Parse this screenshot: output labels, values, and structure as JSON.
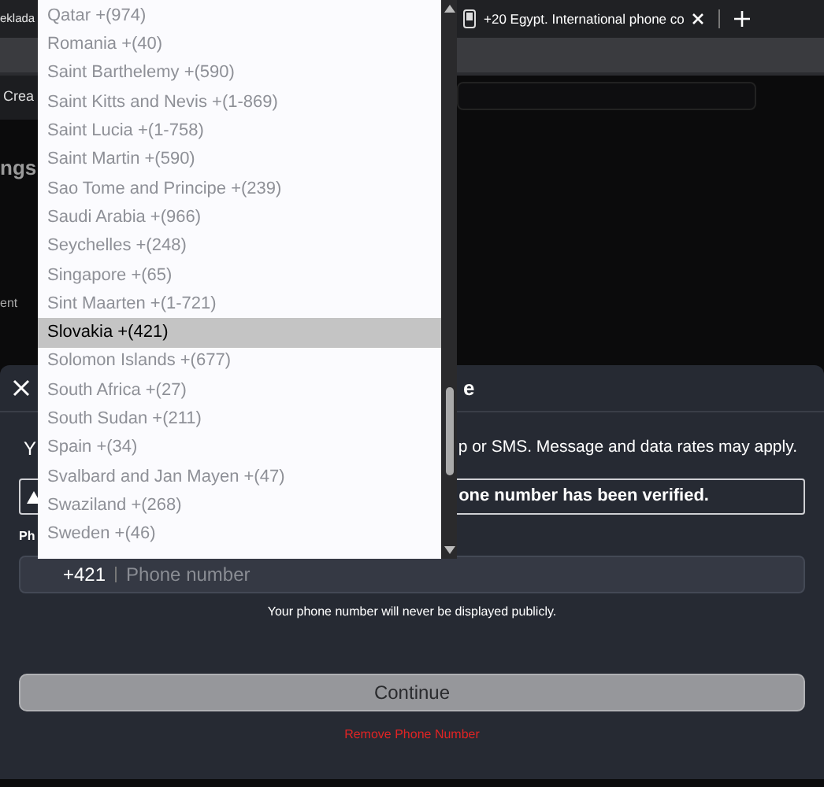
{
  "browser": {
    "tabs": [
      {
        "title": "eklada"
      },
      {
        "title": "+20 Egypt. International phone co"
      }
    ]
  },
  "page": {
    "left_fragments": [
      "Crea",
      "ngs",
      "ent"
    ]
  },
  "dialog": {
    "title": "e",
    "description_start": "Y",
    "description_end": "p or SMS. Message and data rates may apply.",
    "notice": "one number has been verified.",
    "field_label": "Ph",
    "country_code": "+421",
    "placeholder": "Phone number",
    "note": "Your phone number will never be displayed publicly.",
    "continue": "Continue",
    "remove": "Remove Phone Number"
  },
  "dropdown": {
    "items": [
      {
        "label": "Qatar +(974)",
        "selected": false
      },
      {
        "label": "Romania +(40)",
        "selected": false
      },
      {
        "label": "Saint Barthelemy +(590)",
        "selected": false
      },
      {
        "label": "Saint Kitts and Nevis +(1-869)",
        "selected": false
      },
      {
        "label": "Saint Lucia +(1-758)",
        "selected": false
      },
      {
        "label": "Saint Martin +(590)",
        "selected": false
      },
      {
        "label": "Sao Tome and Principe +(239)",
        "selected": false
      },
      {
        "label": "Saudi Arabia +(966)",
        "selected": false
      },
      {
        "label": "Seychelles +(248)",
        "selected": false
      },
      {
        "label": "Singapore +(65)",
        "selected": false
      },
      {
        "label": "Sint Maarten +(1-721)",
        "selected": false
      },
      {
        "label": "Slovakia +(421)",
        "selected": true
      },
      {
        "label": "Solomon Islands +(677)",
        "selected": false
      },
      {
        "label": "South Africa +(27)",
        "selected": false
      },
      {
        "label": "South Sudan +(211)",
        "selected": false
      },
      {
        "label": "Spain +(34)",
        "selected": false
      },
      {
        "label": "Svalbard and Jan Mayen +(47)",
        "selected": false
      },
      {
        "label": "Swaziland +(268)",
        "selected": false
      },
      {
        "label": "Sweden +(46)",
        "selected": false
      }
    ]
  }
}
